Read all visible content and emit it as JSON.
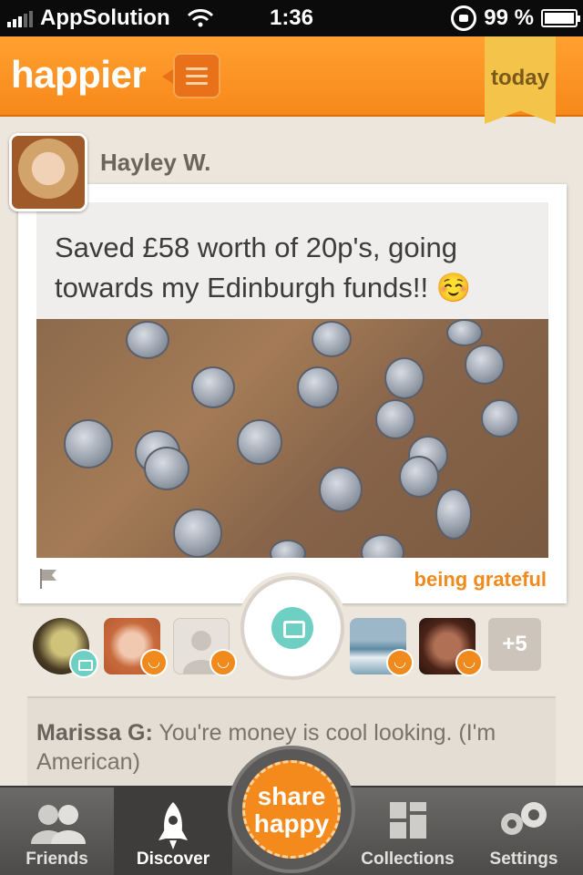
{
  "status_bar": {
    "carrier": "AppSolution",
    "time": "1:36",
    "battery": "99 %"
  },
  "header": {
    "logo": "happier",
    "today_label": "today"
  },
  "post": {
    "author": "Hayley W.",
    "text": "Saved £58 worth of 20p's, going towards my Edinburgh funds!! ☺️",
    "category": "being grateful"
  },
  "friends": {
    "more_count": "+5"
  },
  "comment": {
    "author": "Marissa G:",
    "text": " You're money is cool looking. (I'm American)"
  },
  "tabs": [
    {
      "label": "Friends"
    },
    {
      "label": "Discover"
    },
    {
      "label": "Collections"
    },
    {
      "label": "Settings"
    }
  ],
  "share_button": {
    "line1": "share",
    "line2": "happy"
  },
  "colors": {
    "brand_orange": "#f7891a",
    "accent_teal": "#6ecfc3",
    "ribbon_gold": "#f3c34a"
  }
}
